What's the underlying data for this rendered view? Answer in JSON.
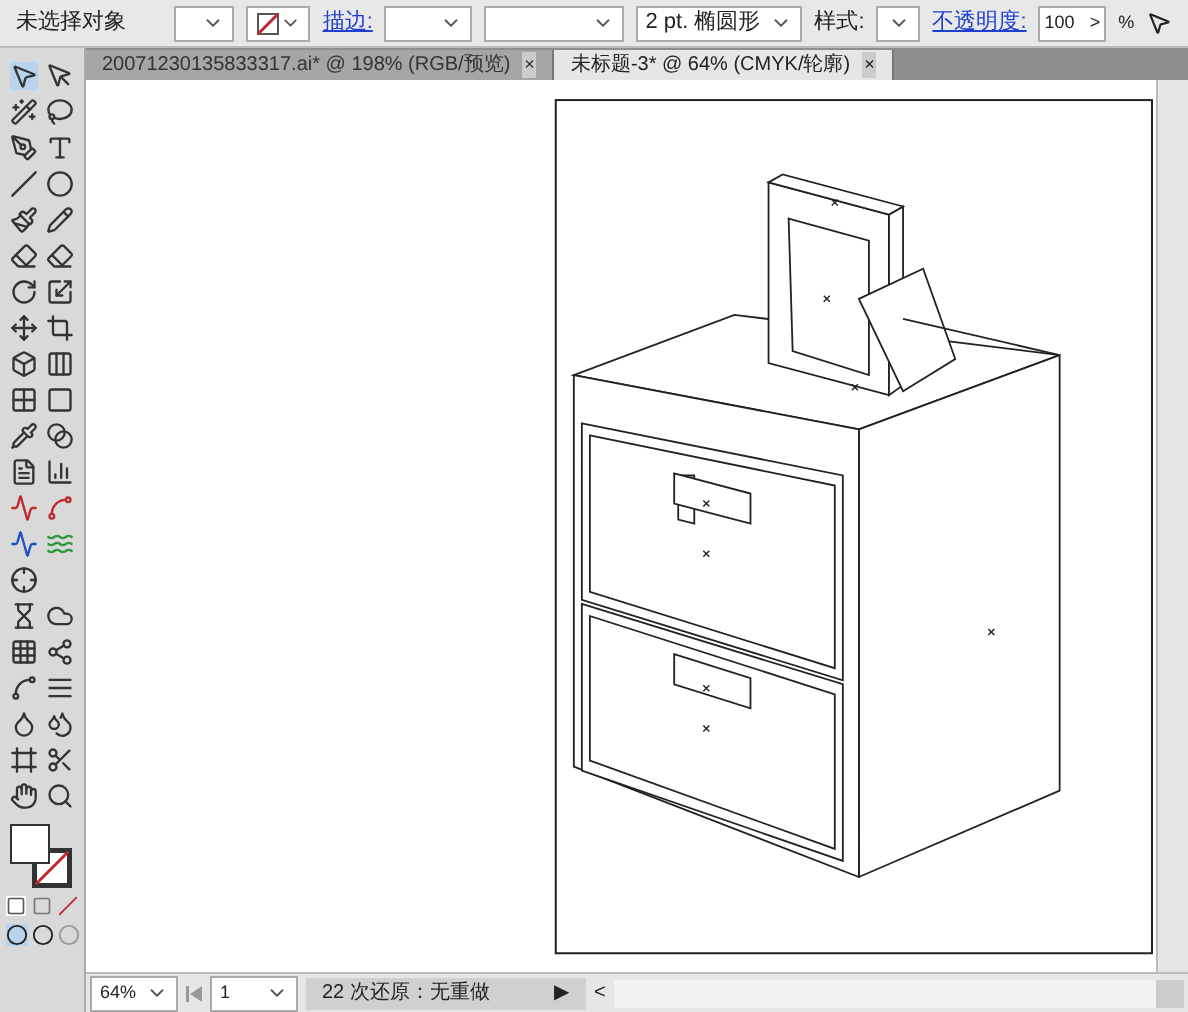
{
  "control_bar": {
    "selection": "未选择对象",
    "stroke_label": "描边:",
    "brush": "2 pt. 椭圆形",
    "style_label": "样式:",
    "opacity_label": "不透明度:",
    "opacity_value": "100",
    "opacity_arrow": ">",
    "opacity_unit": "%"
  },
  "tabs": [
    {
      "label": "20071230135833317.ai* @ 198% (RGB/预览)",
      "selected": false,
      "close": "×"
    },
    {
      "label": "未标题-3* @ 64% (CMYK/轮廓)",
      "selected": true,
      "close": "×"
    }
  ],
  "status_bar": {
    "zoom": "64%",
    "page": "1",
    "status": "22 次还原：无重做",
    "status_arrow": "▶",
    "scroll_arrow": "<"
  }
}
